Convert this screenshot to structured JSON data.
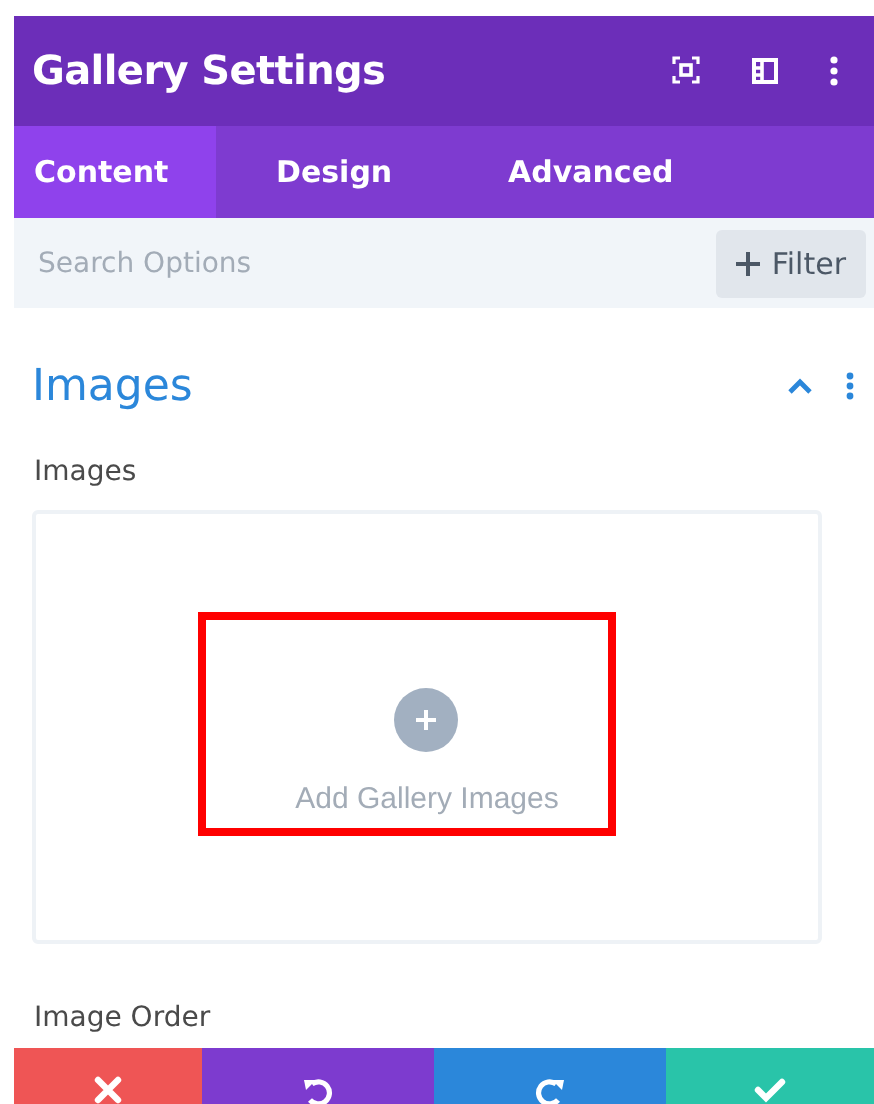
{
  "window": {
    "title": "Gallery Settings"
  },
  "tabs": [
    {
      "label": "Content",
      "selected": true
    },
    {
      "label": "Design",
      "selected": false
    },
    {
      "label": "Advanced",
      "selected": false
    }
  ],
  "search": {
    "placeholder": "Search Options",
    "filter_button": "Filter"
  },
  "section": {
    "title": "Images",
    "expanded": true,
    "fields": [
      {
        "label": "Images",
        "upload_text": "Add Gallery Images",
        "highlighted": true
      }
    ],
    "next_label": "Image Order"
  },
  "actions": [
    {
      "kind": "cancel",
      "color": "#ef5555"
    },
    {
      "kind": "undo",
      "color": "#7d3bcf"
    },
    {
      "kind": "redo",
      "color": "#2b87da"
    },
    {
      "kind": "save",
      "color": "#29c4a9"
    }
  ]
}
